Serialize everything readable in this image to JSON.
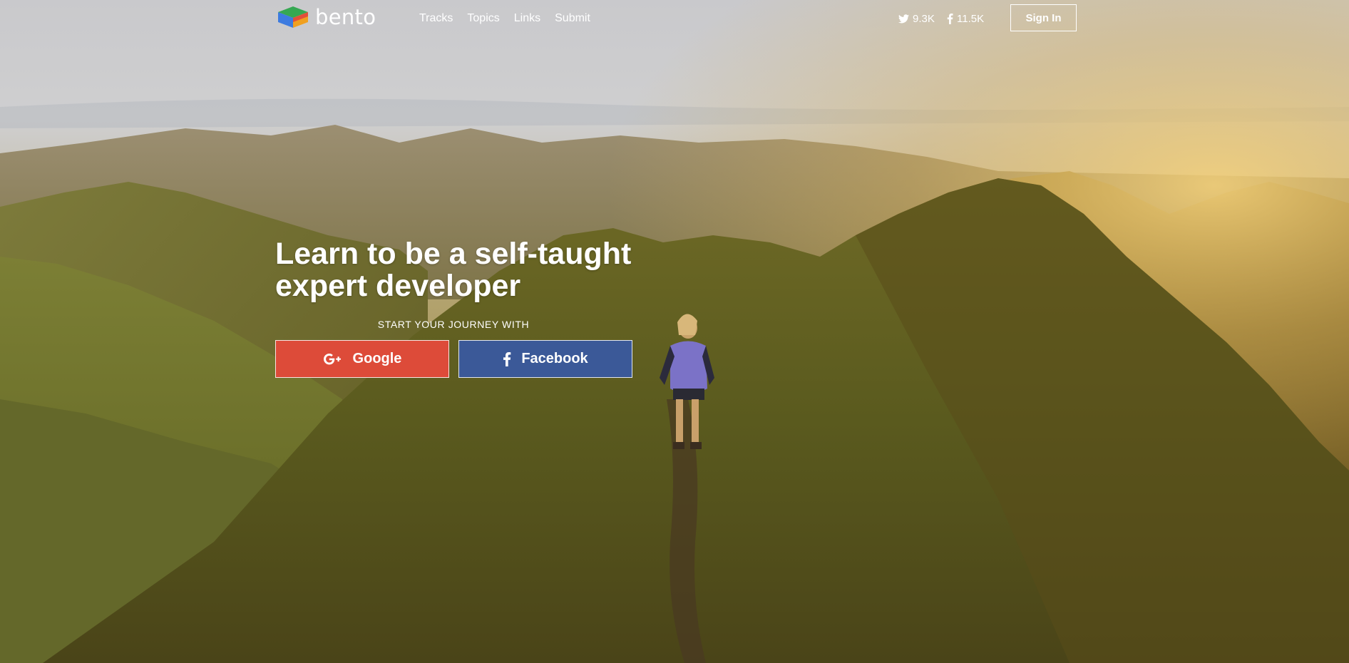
{
  "brand": {
    "name": "bento",
    "icon": "bento-cube-logo"
  },
  "nav": {
    "items": [
      {
        "label": "Tracks"
      },
      {
        "label": "Topics"
      },
      {
        "label": "Links"
      },
      {
        "label": "Submit"
      }
    ]
  },
  "social": {
    "twitter": {
      "icon": "twitter-icon",
      "count": "9.3K"
    },
    "facebook": {
      "icon": "facebook-icon",
      "count": "11.5K"
    }
  },
  "header": {
    "signin_label": "Sign In"
  },
  "hero": {
    "title_line1": "Learn to be a self-taught",
    "title_line2": "expert developer",
    "subtitle": "START YOUR JOURNEY WITH",
    "google_label": "Google",
    "facebook_label": "Facebook"
  },
  "colors": {
    "google": "#dd4b39",
    "facebook": "#3b5998",
    "text": "#ffffff"
  }
}
